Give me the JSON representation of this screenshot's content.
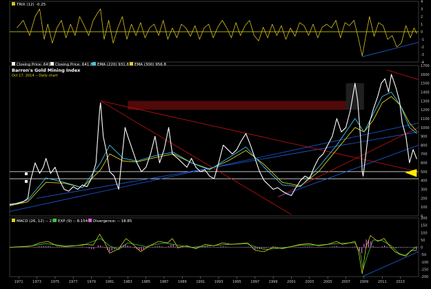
{
  "colors": {
    "background": "#000000",
    "price": "#ffffff",
    "ema_short": "#3fc6e6",
    "ema_long": "#e0d020",
    "trix": "#d8c020",
    "macd": "#d8d020",
    "signal": "#33cc33",
    "divergence": "#e060e0",
    "channel": "#cc1111",
    "trendline": "#1f5fe6",
    "zero_line": "#e8e800",
    "band": "#5a0a0a"
  },
  "chart_data": [
    {
      "type": "line",
      "panel": "trix",
      "legend": [
        {
          "label": "TRIX (12) ",
          "value": "-0.25",
          "color": "#d8c020"
        }
      ],
      "y_ticks": [
        "4",
        "3",
        "2",
        "1",
        "0",
        "-1",
        "-2",
        "-3",
        "-4"
      ],
      "ylim": [
        -4,
        4
      ],
      "series": [
        {
          "name": "TRIX (12)",
          "x": [
            1970.8,
            1971.5,
            1972.2,
            1972.8,
            1973.3,
            1973.8,
            1974.2,
            1974.7,
            1975.2,
            1975.7,
            1976.2,
            1976.7,
            1977.2,
            1977.7,
            1978.2,
            1978.7,
            1979.2,
            1979.7,
            1980.0,
            1980.4,
            1980.9,
            1981.4,
            1981.9,
            1982.4,
            1982.9,
            1983.4,
            1983.9,
            1984.4,
            1984.9,
            1985.4,
            1985.9,
            1986.4,
            1986.9,
            1987.4,
            1987.9,
            1988.4,
            1988.9,
            1989.4,
            1989.9,
            1990.4,
            1990.9,
            1991.4,
            1991.9,
            1992.4,
            1992.9,
            1993.4,
            1993.9,
            1994.4,
            1994.9,
            1995.4,
            1995.9,
            1996.4,
            1996.9,
            1997.4,
            1997.9,
            1998.4,
            1998.9,
            1999.4,
            1999.9,
            2000.4,
            2000.9,
            2001.4,
            2001.9,
            2002.4,
            2002.9,
            2003.4,
            2003.9,
            2004.4,
            2004.9,
            2005.4,
            2005.9,
            2006.4,
            2006.9,
            2007.4,
            2007.9,
            2008.4,
            2008.8,
            2009.2,
            2009.6,
            2010.1,
            2010.6,
            2011.1,
            2011.6,
            2012.1,
            2012.6,
            2013.1,
            2013.6,
            2014.1,
            2014.5,
            2014.8
          ],
          "values": [
            0.5,
            1.5,
            -0.5,
            2.0,
            3.0,
            -1.0,
            1.0,
            -1.5,
            0.5,
            1.5,
            -0.8,
            1.0,
            -0.5,
            2.0,
            0.8,
            -0.5,
            1.5,
            2.5,
            3.0,
            -1.0,
            1.5,
            -1.5,
            0.5,
            2.0,
            -1.0,
            1.0,
            -0.5,
            1.2,
            -0.8,
            0.5,
            1.0,
            -0.5,
            1.5,
            -1.0,
            0.5,
            -0.8,
            1.0,
            0.5,
            -0.6,
            0.8,
            -1.0,
            0.5,
            1.0,
            -0.8,
            0.6,
            1.5,
            0.5,
            -0.8,
            1.2,
            -0.5,
            0.8,
            1.5,
            -0.5,
            -1.2,
            0.6,
            -0.8,
            1.0,
            -0.5,
            0.8,
            -1.0,
            0.5,
            -0.6,
            1.2,
            0.8,
            -0.5,
            1.0,
            -0.8,
            0.6,
            1.0,
            0.5,
            1.5,
            -0.8,
            1.2,
            0.8,
            1.5,
            -1.0,
            -3.2,
            -0.5,
            2.0,
            -0.6,
            1.2,
            0.8,
            -1.0,
            -0.5,
            -2.0,
            -1.5,
            0.8,
            -0.8,
            0.5,
            -0.25
          ]
        }
      ]
    },
    {
      "type": "line",
      "panel": "price",
      "title": "Barron's Gold Mining Index",
      "subtitle": "Oct 17, 2014 -- Daily chart",
      "legend": [
        {
          "label": "Closing Price: 641.8",
          "color": "#ffffff"
        },
        {
          "label": "Closing Price: 641.8",
          "color": "#ffffff"
        },
        {
          "label": "EMA (220) 931.8",
          "color": "#3fc6e6"
        },
        {
          "label": "EMA (300) 956.8",
          "color": "#e0d020"
        }
      ],
      "y_ticks": [
        "1700",
        "1600",
        "1500",
        "1400",
        "1300",
        "1200",
        "1100",
        "1000",
        "900",
        "800",
        "700",
        "600",
        "500",
        "400",
        "300",
        "200",
        "100",
        "0"
      ],
      "ylim": [
        0,
        1700
      ],
      "series": [
        {
          "name": "Closing Price",
          "x": [
            1970.0,
            1970.8,
            1971.5,
            1972.0,
            1972.3,
            1972.8,
            1973.3,
            1973.7,
            1974.0,
            1974.5,
            1975.0,
            1975.5,
            1976.0,
            1976.5,
            1977.0,
            1977.5,
            1978.0,
            1978.5,
            1979.0,
            1979.5,
            1979.9,
            1980.0,
            1980.3,
            1980.7,
            1981.0,
            1981.5,
            1982.0,
            1982.3,
            1982.7,
            1983.0,
            1983.5,
            1984.0,
            1984.5,
            1985.0,
            1985.5,
            1986.0,
            1986.5,
            1987.0,
            1987.5,
            1987.9,
            1988.5,
            1989.0,
            1989.5,
            1990.0,
            1990.5,
            1991.0,
            1991.5,
            1992.0,
            1992.5,
            1993.0,
            1993.5,
            1994.0,
            1994.5,
            1995.0,
            1995.5,
            1996.0,
            1996.5,
            1997.0,
            1997.5,
            1998.0,
            1998.5,
            1999.0,
            1999.5,
            2000.0,
            2000.5,
            2001.0,
            2001.5,
            2002.0,
            2002.5,
            2003.0,
            2003.5,
            2004.0,
            2004.5,
            2005.0,
            2005.5,
            2006.0,
            2006.5,
            2007.0,
            2007.5,
            2008.0,
            2008.3,
            2008.6,
            2008.8,
            2008.9,
            2009.2,
            2009.6,
            2010.0,
            2010.5,
            2010.9,
            2011.3,
            2011.7,
            2012.0,
            2012.5,
            2012.9,
            2013.2,
            2013.6,
            2014.0,
            2014.4,
            2014.8
          ],
          "values": [
            130,
            140,
            160,
            200,
            400,
            600,
            480,
            550,
            650,
            480,
            550,
            400,
            300,
            280,
            330,
            300,
            350,
            330,
            420,
            600,
            1200,
            1280,
            900,
            700,
            500,
            450,
            300,
            600,
            1000,
            900,
            750,
            600,
            500,
            550,
            700,
            900,
            600,
            750,
            1000,
            700,
            650,
            600,
            550,
            650,
            550,
            500,
            520,
            450,
            420,
            600,
            800,
            750,
            700,
            750,
            850,
            930,
            800,
            650,
            500,
            400,
            350,
            300,
            320,
            280,
            250,
            230,
            320,
            400,
            450,
            420,
            550,
            650,
            700,
            800,
            900,
            1100,
            950,
            1000,
            1200,
            1500,
            1300,
            900,
            500,
            450,
            700,
            1050,
            1200,
            1350,
            1500,
            1550,
            1400,
            1600,
            1450,
            1300,
            1050,
            900,
            600,
            750,
            641.8
          ]
        },
        {
          "name": "EMA (220)",
          "x": [
            1970.0,
            1972.0,
            1974.0,
            1976.0,
            1978.0,
            1980.0,
            1981.0,
            1982.5,
            1984.0,
            1986.0,
            1988.0,
            1990.0,
            1992.0,
            1994.0,
            1996.0,
            1998.0,
            2000.0,
            2002.0,
            2004.0,
            2006.0,
            2008.0,
            2009.0,
            2010.0,
            2011.0,
            2012.0,
            2013.0,
            2014.0,
            2014.8
          ],
          "values": [
            120,
            180,
            430,
            380,
            320,
            600,
            800,
            650,
            620,
            680,
            720,
            600,
            520,
            650,
            780,
            550,
            350,
            330,
            550,
            800,
            1100,
            950,
            1150,
            1350,
            1400,
            1250,
            1000,
            931.8
          ]
        },
        {
          "name": "EMA (300)",
          "x": [
            1970.0,
            1972.0,
            1974.0,
            1976.0,
            1978.0,
            1980.0,
            1981.0,
            1982.5,
            1984.0,
            1986.0,
            1988.0,
            1990.0,
            1992.0,
            1994.0,
            1996.0,
            1998.0,
            2000.0,
            2002.0,
            2004.0,
            2006.0,
            2008.0,
            2009.0,
            2010.0,
            2011.0,
            2012.0,
            2013.0,
            2014.0,
            2014.8
          ],
          "values": [
            115,
            160,
            380,
            370,
            320,
            520,
            700,
            620,
            610,
            660,
            700,
            600,
            530,
            620,
            740,
            580,
            380,
            340,
            500,
            750,
            1000,
            950,
            1080,
            1280,
            1350,
            1250,
            1050,
            956.8
          ]
        }
      ]
    },
    {
      "type": "line",
      "panel": "macd",
      "legend": [
        {
          "label": "MACD (26, 12) -- 23",
          "color": "#d8d020"
        },
        {
          "label": "EXP (9) -- 8.154",
          "color": "#33cc33"
        },
        {
          "label": "Divergence: -- 18.85",
          "color": "#e060e0"
        }
      ],
      "y_ticks": [
        "200",
        "150",
        "100",
        "50",
        "0",
        "-50",
        "-100",
        "-150",
        "-200"
      ],
      "ylim": [
        -200,
        200
      ],
      "series": [
        {
          "name": "MACD (26, 12)",
          "x": [
            1970.0,
            1971.5,
            1972.5,
            1973.3,
            1974.2,
            1975.2,
            1976.2,
            1977.2,
            1978.2,
            1979.2,
            1979.9,
            1980.4,
            1981.0,
            1982.0,
            1982.8,
            1983.4,
            1984.4,
            1985.4,
            1986.4,
            1987.4,
            1987.9,
            1988.5,
            1989.5,
            1990.5,
            1991.5,
            1992.5,
            1993.4,
            1994.4,
            1995.4,
            1996.2,
            1997.0,
            1998.0,
            1999.0,
            2000.0,
            2001.0,
            2002.0,
            2003.0,
            2004.0,
            2005.0,
            2006.0,
            2006.6,
            2007.4,
            2008.0,
            2008.4,
            2008.8,
            2009.2,
            2009.7,
            2010.5,
            2011.2,
            2011.8,
            2012.4,
            2013.0,
            2013.6,
            2014.2,
            2014.8
          ],
          "values": [
            0,
            5,
            10,
            30,
            40,
            10,
            5,
            10,
            20,
            15,
            90,
            40,
            -40,
            -10,
            60,
            30,
            -30,
            10,
            40,
            30,
            60,
            0,
            10,
            -10,
            20,
            10,
            30,
            20,
            25,
            30,
            -20,
            -30,
            0,
            -10,
            5,
            20,
            25,
            10,
            20,
            40,
            20,
            30,
            40,
            -30,
            -180,
            0,
            80,
            40,
            60,
            10,
            -30,
            -50,
            -60,
            -20,
            -23
          ]
        },
        {
          "name": "EXP (9)",
          "x": [
            1970.0,
            1972.0,
            1974.0,
            1976.0,
            1978.0,
            1980.0,
            1981.0,
            1982.0,
            1983.0,
            1985.0,
            1987.0,
            1988.0,
            1990.0,
            1992.0,
            1994.0,
            1996.0,
            1998.0,
            2000.0,
            2002.0,
            2004.0,
            2006.0,
            2007.4,
            2008.0,
            2008.6,
            2008.9,
            2009.4,
            2010.0,
            2011.0,
            2012.0,
            2012.8,
            2013.5,
            2014.2,
            2014.8
          ],
          "values": [
            0,
            5,
            25,
            10,
            12,
            60,
            10,
            -15,
            30,
            5,
            30,
            20,
            0,
            10,
            20,
            25,
            -15,
            -5,
            15,
            15,
            25,
            30,
            30,
            -40,
            -150,
            -50,
            50,
            45,
            10,
            -40,
            -55,
            -25,
            8.154
          ]
        }
      ]
    }
  ],
  "x_axis": {
    "ticks": [
      "1971",
      "1973",
      "1975",
      "1977",
      "1979",
      "1981",
      "1983",
      "1985",
      "1987",
      "1989",
      "1991",
      "1993",
      "1995",
      "1997",
      "1999",
      "2001",
      "2003",
      "2005",
      "2007",
      "2009",
      "2011",
      "2013"
    ],
    "tick_values": [
      1971,
      1973,
      1975,
      1977,
      1979,
      1981,
      1983,
      1985,
      1987,
      1989,
      1991,
      1993,
      1995,
      1997,
      1999,
      2001,
      2003,
      2005,
      2007,
      2009,
      2011,
      2013
    ],
    "xlim": [
      1970.0,
      2015.0
    ]
  },
  "annotations": {
    "channel_upper": {
      "x": [
        1980.0,
        2015.0
      ],
      "y": [
        1300,
        500
      ]
    },
    "channel_lower": {
      "x": [
        1999.5,
        2015.0
      ],
      "y": [
        215,
        1000
      ]
    },
    "channel_bottom": {
      "x": [
        1980.0,
        2001.0
      ],
      "y": [
        1300,
        15
      ]
    },
    "upper_right_channel": {
      "x": [
        2011.5,
        2015.0
      ],
      "y": [
        1650,
        1540
      ]
    },
    "trendlines": [
      {
        "x": [
          1970.0,
          2015.0
        ],
        "y": [
          50,
          1050
        ]
      },
      {
        "x": [
          1973.0,
          2015.0
        ],
        "y": [
          200,
          950
        ]
      },
      {
        "x": [
          1999.5,
          2015.0
        ],
        "y": [
          215,
          800
        ]
      }
    ],
    "support_lines": [
      500,
      420
    ],
    "resistance_band": {
      "x": [
        1983.0,
        2007.0
      ],
      "y": [
        1200,
        1300
      ]
    },
    "shaded_region": {
      "x": [
        2007.0,
        2009.0
      ],
      "y": [
        1200,
        1500
      ]
    },
    "target_marker": {
      "x": [
        2013.5,
        2014.8
      ],
      "y": [
        490,
        440
      ]
    },
    "trix_trendline": {
      "x": [
        2008.8,
        2015.0
      ],
      "y": [
        -3.3,
        -1.4
      ]
    },
    "macd_trendline": {
      "x": [
        2008.8,
        2015.0
      ],
      "y": [
        -200,
        -30
      ]
    }
  }
}
